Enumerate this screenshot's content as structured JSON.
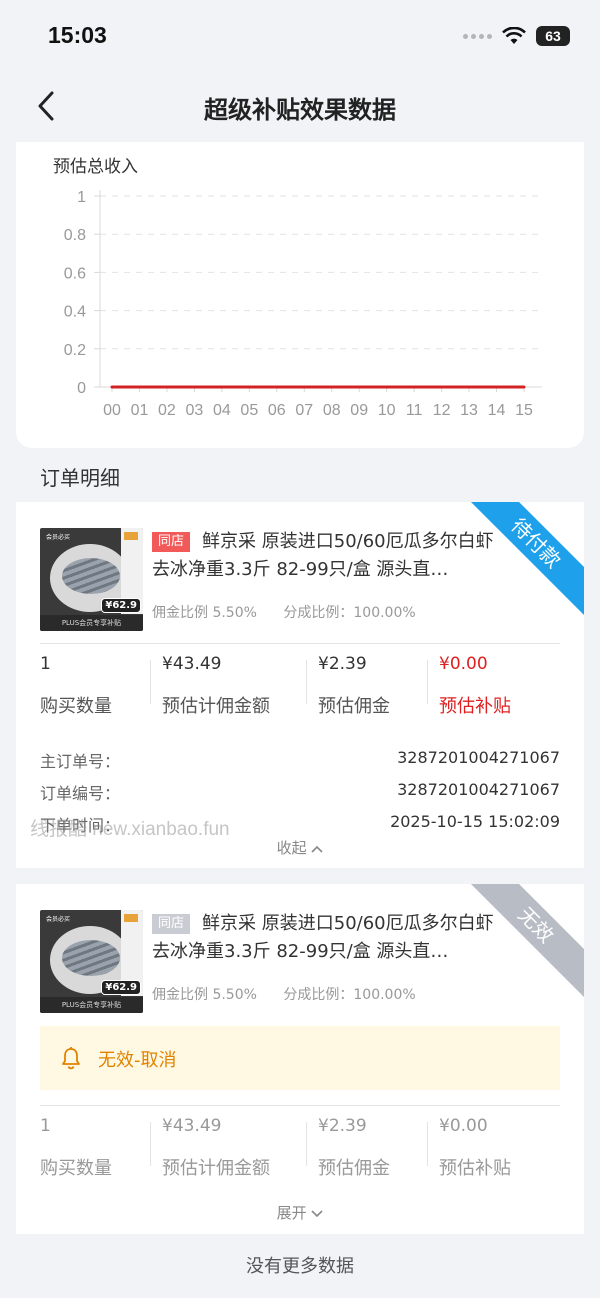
{
  "status": {
    "time": "15:03",
    "battery": "63"
  },
  "header": {
    "title": "超级补贴效果数据"
  },
  "chart_data": {
    "type": "line",
    "label": "预估总收入",
    "categories": [
      "00",
      "01",
      "02",
      "03",
      "04",
      "05",
      "06",
      "07",
      "08",
      "09",
      "10",
      "11",
      "12",
      "13",
      "14",
      "15"
    ],
    "series": [
      {
        "values": [
          0,
          0,
          0,
          0,
          0,
          0,
          0,
          0,
          0,
          0,
          0,
          0,
          0,
          0,
          0,
          0
        ],
        "color": "#d32222"
      }
    ],
    "y_ticks": [
      "0",
      "0.2",
      "0.4",
      "0.6",
      "0.8",
      "1"
    ],
    "ylim": [
      0,
      1
    ],
    "grid": "dashed horizontal"
  },
  "section_title": "订单明细",
  "orders": [
    {
      "ribbon": "待付款",
      "tag": "同店",
      "title": "鲜京采 原装进口50/60厄瓜多尔白虾 去冰净重3.3斤 82-99只/盒 源头直…",
      "commission_rate": "佣金比例 5.50%",
      "share_rate": "分成比例：100.00%",
      "thumb_price": "¥62.9",
      "thumb_footer": "PLUS会员专享补贴",
      "thumb_logo": "会员必买",
      "stats": [
        {
          "value": "1",
          "label": "购买数量"
        },
        {
          "value": "¥43.49",
          "label": "预估计佣金额"
        },
        {
          "value": "¥2.39",
          "label": "预估佣金"
        },
        {
          "value": "¥0.00",
          "label": "预估补贴"
        }
      ],
      "info": [
        {
          "key": "主订单号：",
          "value": "3287201004271067"
        },
        {
          "key": "订单编号：",
          "value": "3287201004271067"
        },
        {
          "key": "下单时间：",
          "value": "2025-10-15 15:02:09"
        }
      ],
      "toggle": "收起"
    },
    {
      "ribbon": "无效",
      "tag": "同店",
      "title": "鲜京采 原装进口50/60厄瓜多尔白虾 去冰净重3.3斤 82-99只/盒 源头直…",
      "commission_rate": "佣金比例 5.50%",
      "share_rate": "分成比例：100.00%",
      "thumb_price": "¥62.9",
      "thumb_footer": "PLUS会员专享补贴",
      "thumb_logo": "会员必买",
      "notice": "无效-取消",
      "stats": [
        {
          "value": "1",
          "label": "购买数量"
        },
        {
          "value": "¥43.49",
          "label": "预估计佣金额"
        },
        {
          "value": "¥2.39",
          "label": "预估佣金"
        },
        {
          "value": "¥0.00",
          "label": "预估补贴"
        }
      ],
      "toggle": "展开"
    }
  ],
  "watermark": "线报酷 new.xianbao.fun",
  "footer": "没有更多数据",
  "colors": {
    "ribbon_pending": "#1ea1ea",
    "ribbon_invalid": "#b8bcc4",
    "red": "#e02020",
    "notice_bg": "#fff8e2",
    "notice_text": "#e08400"
  }
}
